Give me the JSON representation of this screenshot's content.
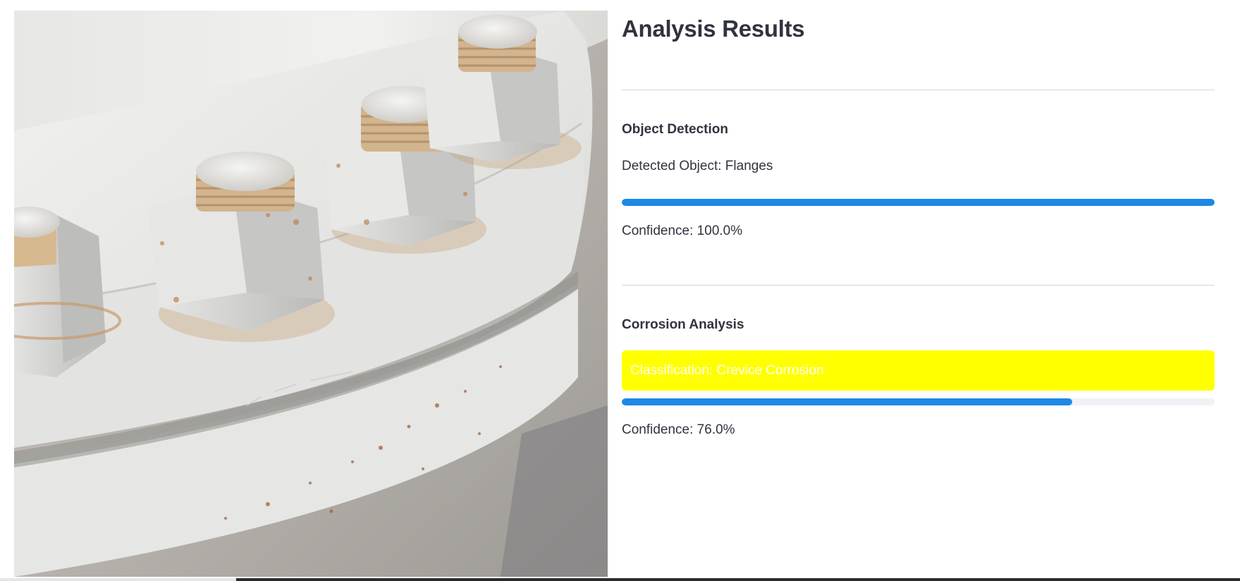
{
  "image": {
    "alt": ""
  },
  "results": {
    "title": "Analysis Results",
    "object_detection": {
      "heading": "Object Detection",
      "detected_text": "Detected Object: Flanges",
      "confidence_value": 1.0,
      "confidence_text": "Confidence: 100.0%"
    },
    "corrosion_analysis": {
      "heading": "Corrosion Analysis",
      "classification_text": "Classification: Crevice Corrosion",
      "classification_color": "#ffff00",
      "confidence_value": 0.76,
      "confidence_text": "Confidence: 76.0%"
    },
    "progress_color": "#1e88e5"
  }
}
